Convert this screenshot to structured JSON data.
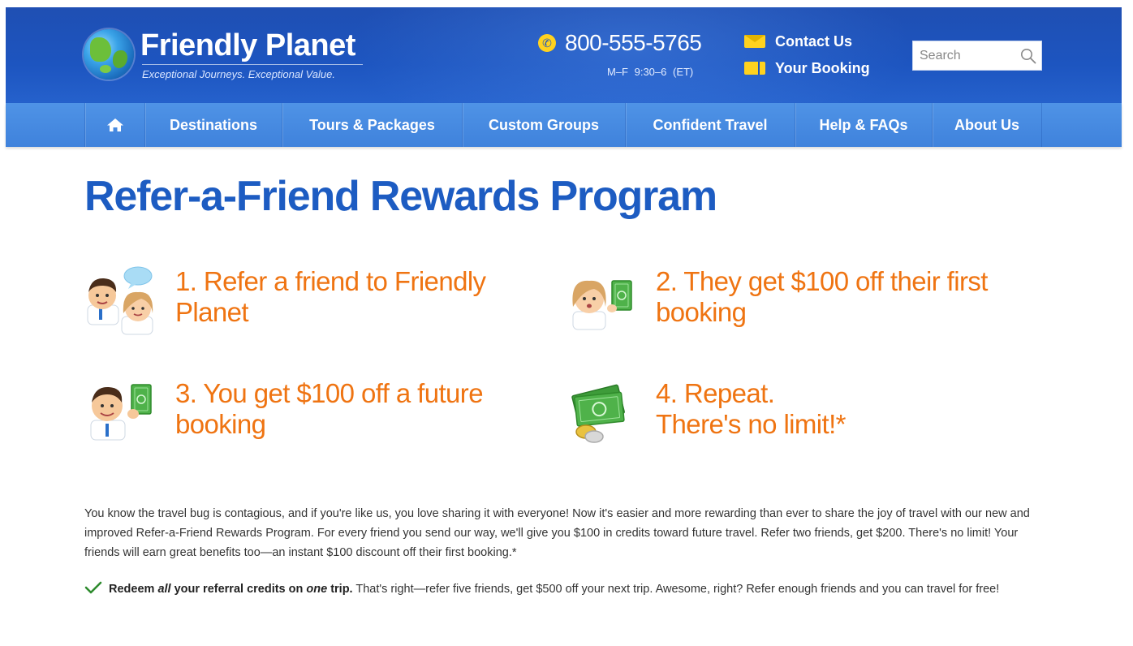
{
  "header": {
    "brand": "Friendly Planet",
    "tagline": "Exceptional Journeys.  Exceptional Value.",
    "phone": "800-555-5765",
    "hours": "M–F 9:30–6 (ET)",
    "contact_label": "Contact Us",
    "booking_label": "Your Booking",
    "search_placeholder": "Search"
  },
  "nav": {
    "items": [
      {
        "label": "Destinations"
      },
      {
        "label": "Tours & Packages"
      },
      {
        "label": "Custom Groups"
      },
      {
        "label": "Confident Travel"
      },
      {
        "label": "Help & FAQs"
      },
      {
        "label": "About Us"
      }
    ]
  },
  "main": {
    "title": "Refer-a-Friend Rewards Program",
    "steps": [
      {
        "line1": "1. Refer a friend to Friendly",
        "line2": "Planet",
        "icon": "two-people-chat-icon"
      },
      {
        "line1": "2. They get $100 off their first",
        "line2": "booking",
        "icon": "woman-with-cash-icon"
      },
      {
        "line1": "3. You get $100 off a future",
        "line2": "booking",
        "icon": "man-with-cash-icon"
      },
      {
        "line1": "4. Repeat.",
        "line2": "There's no limit!*",
        "icon": "money-stack-icon"
      }
    ],
    "intro": "You know the travel bug is contagious, and if you're like us, you love sharing it with everyone! Now it's easier and more rewarding than ever to share the joy of travel with our new and improved Refer-a-Friend Rewards Program. For every friend you send our way, we'll give you $100 in credits toward future travel. Refer two friends, get $200. There's no limit! Your friends will earn great benefits too—an instant $100 discount off their first booking.*",
    "redeem": {
      "bold_1": "Redeem ",
      "bold_italic_1": "all",
      "bold_2": " your referral credits on ",
      "bold_italic_2": "one",
      "bold_3": " trip.",
      "rest": " That's right—refer five friends, get $500 off your next trip. Awesome, right? Refer enough friends and you can travel for free!"
    }
  },
  "colors": {
    "header_blue": "#1d55c0",
    "nav_blue": "#4a8de2",
    "title_blue": "#1d5cc2",
    "step_orange": "#ef7412",
    "accent_yellow": "#ffd21f",
    "check_green": "#2e8b2e"
  }
}
